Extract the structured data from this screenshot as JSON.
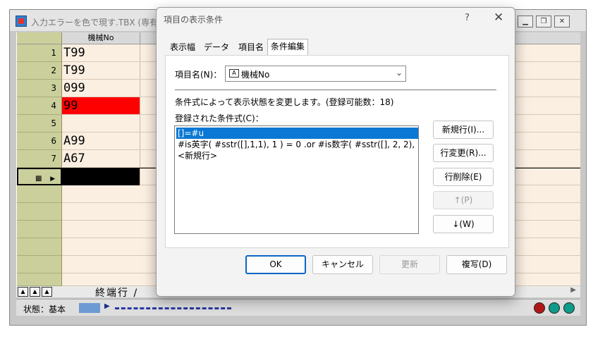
{
  "bg_window": {
    "title": "入力エラーを色で現す.TBX (専有)",
    "column_header": "機械No",
    "rows": [
      {
        "num": "1",
        "value": "T99"
      },
      {
        "num": "2",
        "value": "T99"
      },
      {
        "num": "3",
        "value": "099"
      },
      {
        "num": "4",
        "value": "99"
      },
      {
        "num": "5",
        "value": ""
      },
      {
        "num": "6",
        "value": "A99"
      },
      {
        "num": "7",
        "value": "A67"
      }
    ],
    "end_row_label": "終端行 /",
    "status_text": "状態：基本",
    "colors": {
      "error_cell": "#ff0000",
      "active_cell": "#000000"
    }
  },
  "dialog": {
    "title": "項目の表示条件",
    "help": "?",
    "close": "✕",
    "tabs": [
      "表示幅",
      "データ",
      "項目名",
      "条件編集"
    ],
    "active_tab": "条件編集",
    "field_label": "項目名(N)：",
    "field_icon_text": "A",
    "field_value": "機械No",
    "info_text": "条件式によって表示状態を変更します。(登録可能数：18)",
    "list_label": "登録された条件式(C)：",
    "conditions": [
      "[]=#u",
      "#is英字( #sstr([],1,1), 1 ) = 0 .or #is数字( #sstr([], 2, 2), 2 ) = 0",
      "<新規行>"
    ],
    "side_buttons": {
      "new_row": "新規行(I)...",
      "change_row": "行変更(R)...",
      "delete_row": "行削除(E)",
      "move_up": "↑(P)",
      "move_down": "↓(W)"
    },
    "footer_buttons": {
      "ok": "OK",
      "cancel": "キャンセル",
      "update": "更新",
      "duplicate": "複写(D)"
    }
  }
}
